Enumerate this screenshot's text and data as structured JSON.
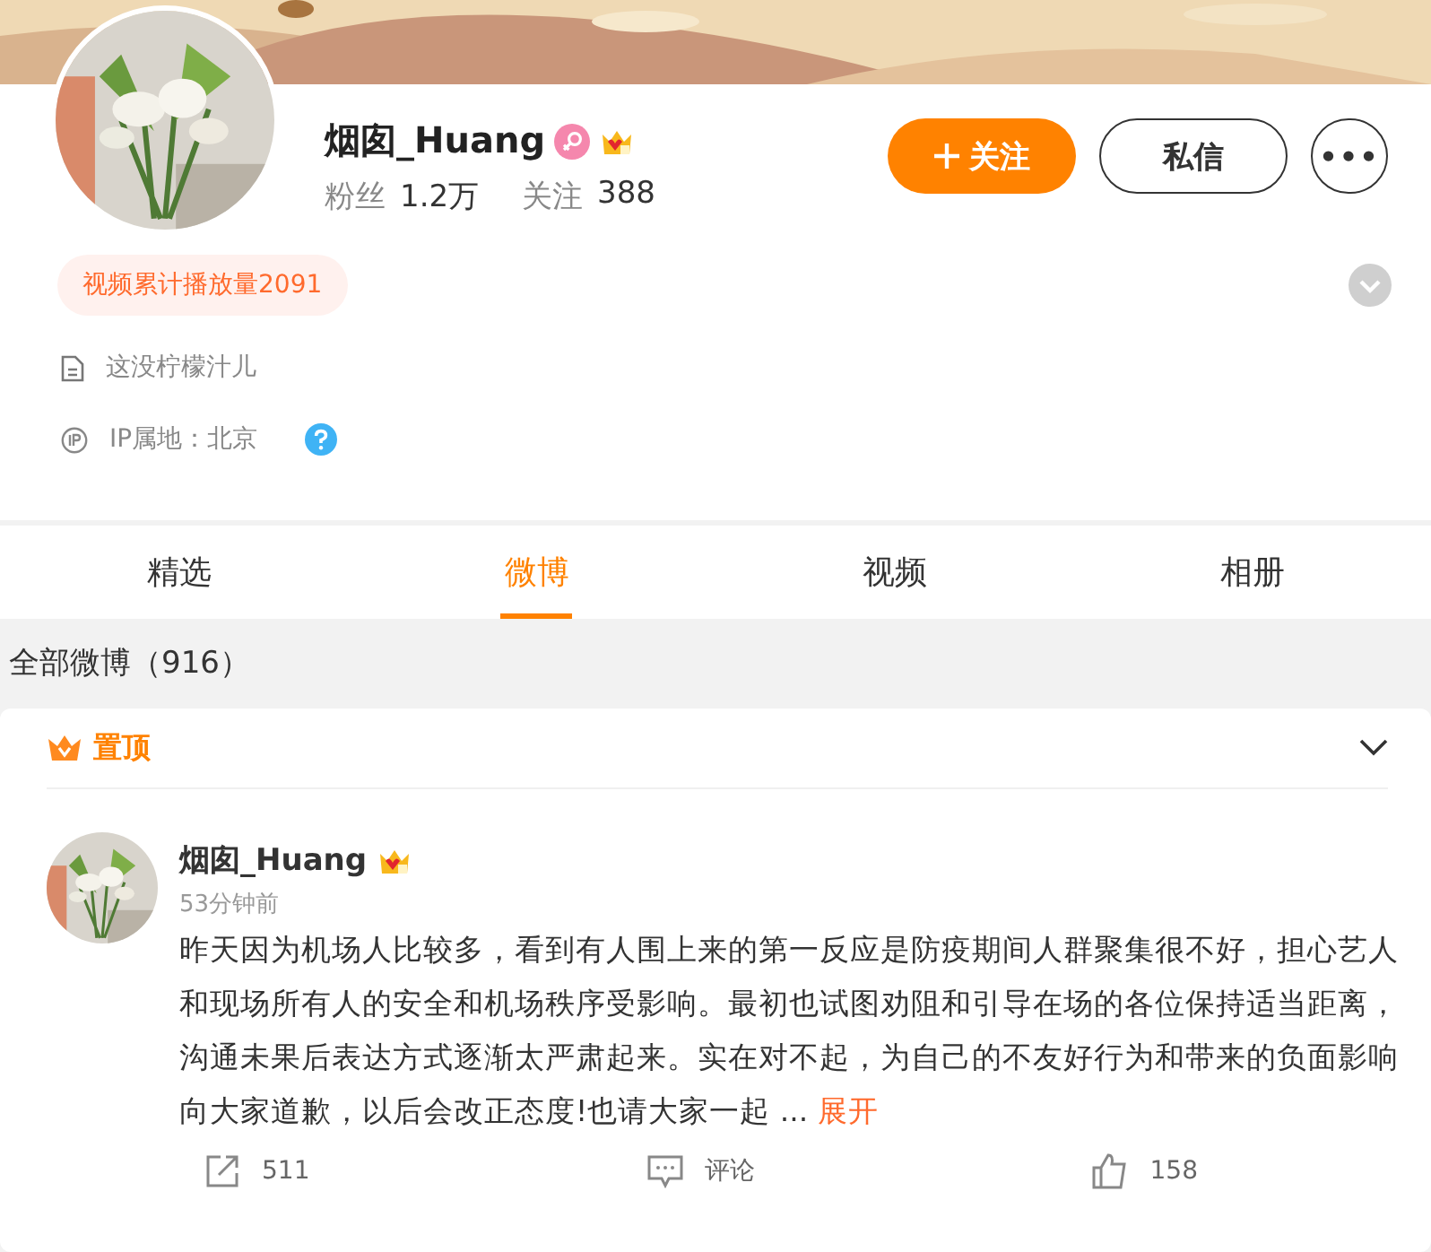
{
  "profile": {
    "name": "烟囱_Huang",
    "followers_label": "粉丝",
    "followers": "1.2万",
    "following_label": "关注",
    "following": "388",
    "follow_button": "关注",
    "message_button": "私信",
    "more_button": "•••",
    "badge": "视频累计播放量2091",
    "bio": "这没柠檬汁儿",
    "ip_location": "IP属地：北京"
  },
  "tabs": [
    {
      "label": "精选",
      "selected": false
    },
    {
      "label": "微博",
      "selected": true
    },
    {
      "label": "视频",
      "selected": false
    },
    {
      "label": "相册",
      "selected": false
    }
  ],
  "feed_header": "全部微博（916）",
  "pinned_label": "置顶",
  "post": {
    "author": "烟囱_Huang",
    "time": "53分钟前",
    "text": "昨天因为机场人比较多，看到有人围上来的第一反应是防疫期间人群聚集很不好，担心艺人和现场所有人的安全和机场秩序受影响。最初也试图劝阻和引导在场的各位保持适当距离，沟通未果后表达方式逐渐太严肃起来。实在对不起，为自己的不友好行为和带来的负面影响向大家道歉，以后会改正态度!也请大家一起 ...",
    "more_link": "展开",
    "reposts": "511",
    "comments": "评论",
    "likes": "158"
  }
}
